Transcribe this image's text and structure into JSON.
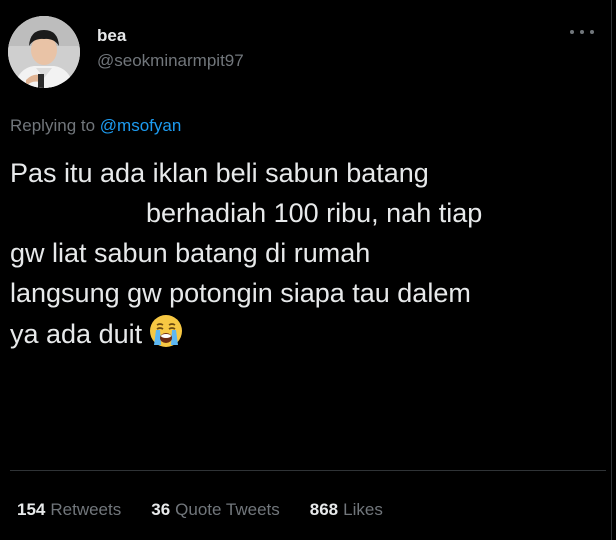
{
  "author": {
    "display_name": "bea",
    "handle": "@seokminarmpit97"
  },
  "reply": {
    "prefix": "Replying to ",
    "mention": "@msofyan"
  },
  "tweet": {
    "lines": [
      "Pas itu ada iklan beli sabun batang",
      "berhadiah 100 ribu, nah tiap",
      "gw liat sabun batang di rumah",
      "langsung gw potongin siapa tau dalem",
      "ya ada duit"
    ],
    "emoji": "loudly-crying-face-emoji"
  },
  "stats": {
    "retweets_count": "154",
    "retweets_label": "Retweets",
    "quotes_count": "36",
    "quotes_label": "Quote Tweets",
    "likes_count": "868",
    "likes_label": "Likes"
  },
  "colors": {
    "background": "#000000",
    "text": "#e7e9ea",
    "muted": "#71767b",
    "link": "#1d9bf0",
    "divider": "#2f3336"
  }
}
